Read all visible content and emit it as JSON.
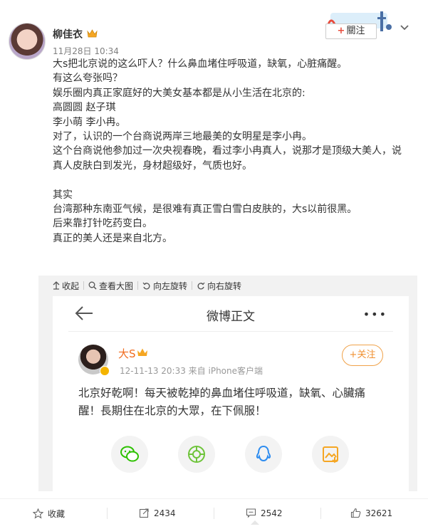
{
  "post": {
    "author_name": "柳佳衣",
    "time": "11月28日 10:34",
    "follow_label": "關注",
    "content_lines": [
      "大s把北京说的这么吓人？什么鼻血堵住呼吸道，缺氧，心脏痛醒。",
      "有这么夸张吗？",
      "娱乐圈内真正家庭好的大美女基本都是从小生活在北京的:",
      "高圆圆 赵子琪",
      "李小萌 李小冉。",
      "对了，认识的一个台商说两岸三地最美的女明星是李小冉。",
      "这个台商说他参加过一次央视春晚，看过李小冉真人，说那才是顶级大美人，说",
      "真人皮肤白到发光，身材超级好，气质也好。",
      "",
      "其实",
      "台湾那种东南亚气候，是很难有真正雪白雪白皮肤的，大s以前很黑。",
      "后来靠打针吃药变白。",
      "真正的美人还是来自北方。"
    ]
  },
  "media_tools": {
    "collapse": "收起",
    "view_large": "查看大图",
    "rotate_left": "向左旋转",
    "rotate_right": "向右旋转"
  },
  "embedded": {
    "nav_title": "微博正文",
    "author": "大S",
    "time_source": "12-11-13 20:33  来自 iPhone客户端",
    "follow": "+关注",
    "text_lines": [
      "北京好乾啊！每天被乾掉的鼻血堵住呼吸道，缺氧、心臟痛",
      "醒！長期住在北京的大眾，在下佩服！"
    ]
  },
  "actions": {
    "favorite": "收藏",
    "repost": "2434",
    "comment": "2542",
    "like": "32621"
  },
  "colors": {
    "accent_orange": "#f06c1f",
    "follow_plus": "#e84c3d",
    "wechat_green": "#2dc100",
    "moments_green": "#6ec43a",
    "qq_blue": "#2d8cf0",
    "album_orange": "#f5a623"
  }
}
